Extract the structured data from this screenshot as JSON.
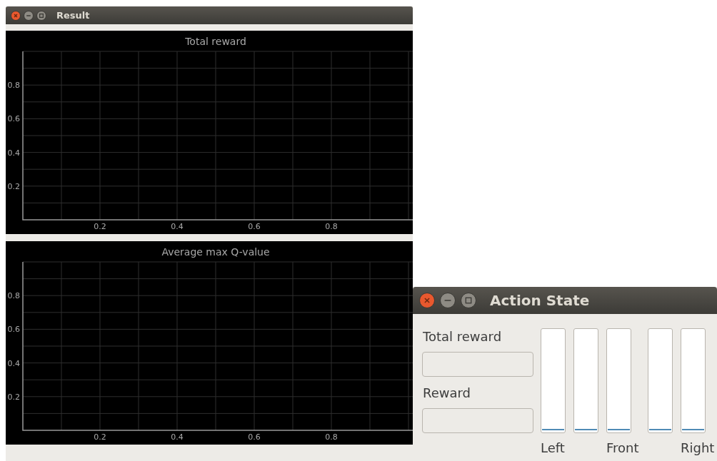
{
  "result_window": {
    "title": "Result",
    "charts": [
      {
        "chart_data": {
          "type": "line",
          "title": "Total reward",
          "xlim": [
            0,
            1
          ],
          "ylim": [
            0,
            1
          ],
          "xticks": [
            0.2,
            0.4,
            0.6,
            0.8
          ],
          "yticks": [
            0.2,
            0.4,
            0.6,
            0.8
          ],
          "grid": true
        }
      },
      {
        "chart_data": {
          "type": "line",
          "title": "Average max Q-value",
          "xlim": [
            0,
            1
          ],
          "ylim": [
            0,
            1
          ],
          "xticks": [
            0.2,
            0.4,
            0.6,
            0.8
          ],
          "yticks": [
            0.2,
            0.4,
            0.6,
            0.8
          ],
          "grid": true
        }
      }
    ]
  },
  "action_window": {
    "title": "Action State",
    "fields": [
      {
        "label": "Total reward"
      },
      {
        "label": "Reward"
      }
    ],
    "bar_groups": [
      [
        {
          "level": 0,
          "label": "Left"
        },
        {
          "level": 0
        },
        {
          "level": 0,
          "label": "Front"
        }
      ],
      [
        {
          "level": 0
        },
        {
          "level": 0,
          "label": "Right"
        }
      ]
    ]
  }
}
